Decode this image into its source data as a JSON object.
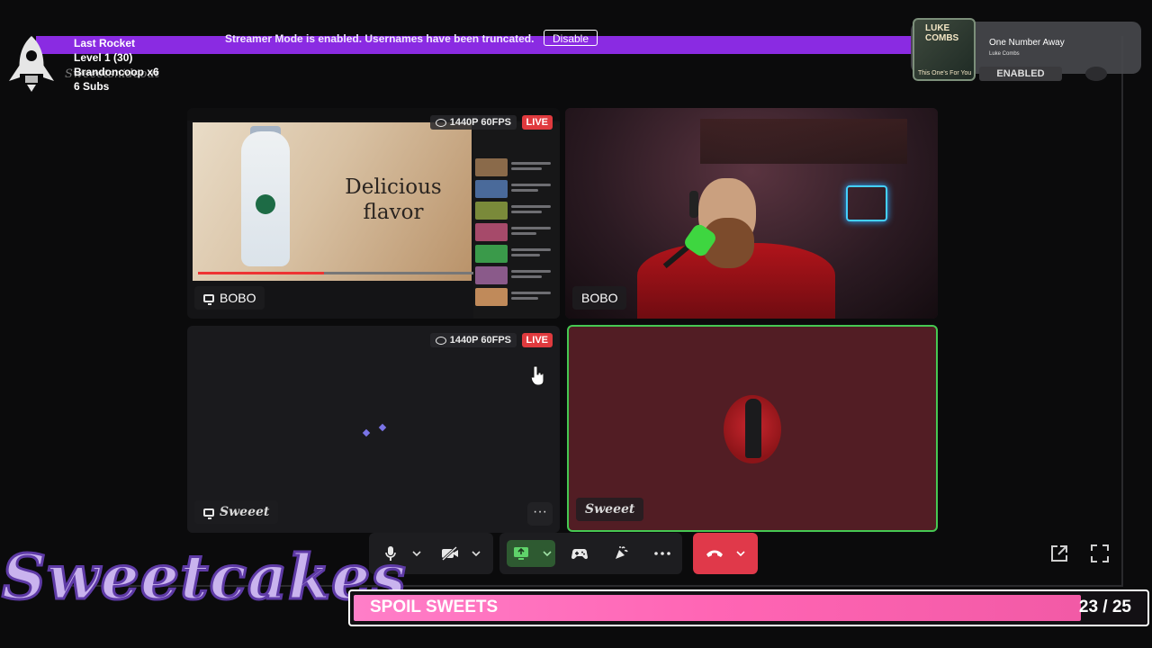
{
  "banner": {
    "text": "Streamer Mode is enabled. Usernames have been truncated.",
    "button_label": "Disable"
  },
  "rocket_alert": {
    "title": "Last Rocket",
    "level": "Level 1  (30)",
    "user": "Brandoncoop x6",
    "subs": "6 Subs",
    "faded_user": "Sweeetsnideout"
  },
  "now_playing": {
    "title": "One Number Away",
    "artist": "Luke Combs",
    "art_label_top": "LUKE COMBS",
    "art_label_bottom": "This One's For You"
  },
  "status_badge": "ENABLED",
  "tiles": [
    {
      "name": "BOBO",
      "quality": "1440P 60FPS",
      "live": "LIVE",
      "video_text_1": "Delicious",
      "video_text_2": "flavor"
    },
    {
      "name": "BOBO"
    },
    {
      "name": "Sweeet",
      "quality": "1440P 60FPS",
      "live": "LIVE",
      "more": "···"
    },
    {
      "name": "Sweeet"
    }
  ],
  "brand_text": "Sweetcakes",
  "goal": {
    "label": "SPOIL SWEETS",
    "current": 23,
    "target": 25,
    "count_text": "23 / 25",
    "progress": 0.92
  },
  "colors": {
    "banner": "#8a2be2",
    "live": "#e03a3e",
    "speaking_border": "#46c852",
    "hangup": "#e0394a",
    "goal_fill": "#ff65b4"
  }
}
